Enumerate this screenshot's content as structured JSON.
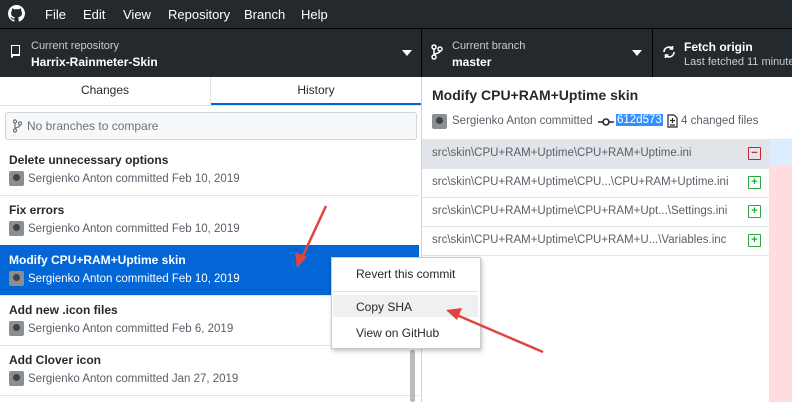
{
  "menu": {
    "items": [
      "File",
      "Edit",
      "View",
      "Repository",
      "Branch",
      "Help"
    ]
  },
  "toolbar": {
    "repo": {
      "label": "Current repository",
      "value": "Harrix-Rainmeter-Skin"
    },
    "branch": {
      "label": "Current branch",
      "value": "master"
    },
    "fetch": {
      "label": "Fetch origin",
      "sub": "Last fetched 11 minute"
    }
  },
  "tabs": {
    "changes": "Changes",
    "history": "History",
    "active": "History"
  },
  "compare": {
    "placeholder": "No branches to compare"
  },
  "commits": [
    {
      "title": "Delete unnecessary options",
      "meta": "Sergienko Anton committed Feb 10, 2019"
    },
    {
      "title": "Fix errors",
      "meta": "Sergienko Anton committed Feb 10, 2019"
    },
    {
      "title": "Modify CPU+RAM+Uptime skin",
      "meta": "Sergienko Anton committed Feb 10, 2019"
    },
    {
      "title": "Add new .icon files",
      "meta": "Sergienko Anton committed Feb 6, 2019"
    },
    {
      "title": "Add Clover icon",
      "meta": "Sergienko Anton committed Jan 27, 2019"
    }
  ],
  "details": {
    "title": "Modify CPU+RAM+Uptime skin",
    "author": "Sergienko Anton committed",
    "sha": "612d573",
    "changed": "4 changed files",
    "files": [
      {
        "path": "src\\skin\\CPU+RAM+Uptime\\CPU+RAM+Uptime.ini",
        "status": "deleted"
      },
      {
        "path": "src\\skin\\CPU+RAM+Uptime\\CPU...\\CPU+RAM+Uptime.ini",
        "status": "added"
      },
      {
        "path": "src\\skin\\CPU+RAM+Uptime\\CPU+RAM+Upt...\\Settings.ini",
        "status": "added"
      },
      {
        "path": "src\\skin\\CPU+RAM+Uptime\\CPU+RAM+U...\\Variables.inc",
        "status": "added"
      }
    ]
  },
  "context_menu": {
    "items": [
      "Revert this commit",
      "Copy SHA",
      "View on GitHub"
    ],
    "highlighted": "Copy SHA"
  },
  "colors": {
    "toolbar": "#24292e",
    "selected": "#0366d6",
    "annotation_arrow": "#e0443e"
  }
}
